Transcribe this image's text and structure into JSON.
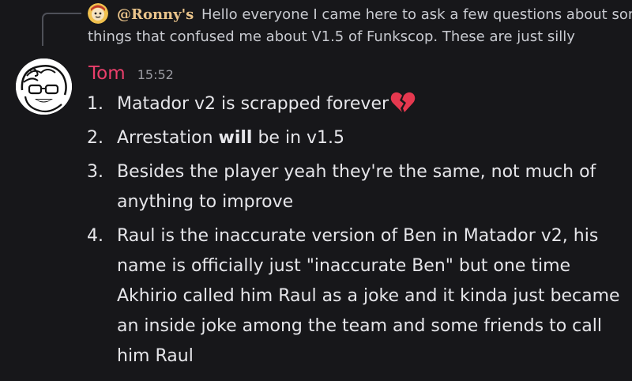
{
  "reply": {
    "author": "@Ronny's",
    "text_line1": "Hello everyone I came here to ask a few questions about some",
    "text_line2": "things that confused me about V1.5 of Funkscop.  These are just silly"
  },
  "message": {
    "author": "Tom",
    "timestamp": "15:52",
    "items": [
      {
        "num": "1.",
        "text": "Matador v2 is scrapped forever",
        "emoji": "broken-heart-icon"
      },
      {
        "num": "2.",
        "pre": "Arrestation ",
        "bold": "will",
        "post": " be in v1.5"
      },
      {
        "num": "3.",
        "text": "Besides the player yeah they're the same, not much of anything to improve"
      },
      {
        "num": "4.",
        "text": "Raul is the inaccurate version of Ben in Matador v2, his name is officially just \"inaccurate Ben\" but one time Akhirio called him Raul as a joke and it kinda just became an inside joke among the team and some friends to call him Raul"
      }
    ]
  },
  "colors": {
    "background": "#17171a",
    "username": "#ea3f6b",
    "reply_name": "#eac48b",
    "text": "#e6e6ea",
    "muted": "#9b9ca3",
    "broken_heart": "#e5384f"
  }
}
